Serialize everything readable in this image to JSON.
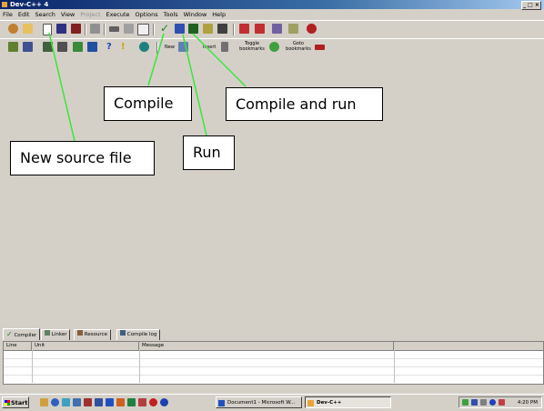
{
  "window": {
    "title": "Dev-C++ 4",
    "controls": "_ □ ×"
  },
  "menu": [
    {
      "label": "File",
      "dim": false
    },
    {
      "label": "Edit",
      "dim": false
    },
    {
      "label": "Search",
      "dim": false
    },
    {
      "label": "View",
      "dim": false
    },
    {
      "label": "Project",
      "dim": true
    },
    {
      "label": "Execute",
      "dim": false
    },
    {
      "label": "Options",
      "dim": false
    },
    {
      "label": "Tools",
      "dim": false
    },
    {
      "label": "Window",
      "dim": false
    },
    {
      "label": "Help",
      "dim": false
    }
  ],
  "toolbar2": {
    "new_label": "New",
    "insert_label": "Insert",
    "toggle_label": "Toggle bookmarks",
    "goto_label": "Goto bookmarks"
  },
  "callouts": {
    "compile": "Compile",
    "compile_and_run": "Compile and run",
    "run": "Run",
    "new_source_file": "New source file"
  },
  "bottom_tabs": [
    "Compiler",
    "Linker",
    "Resource",
    "Compile log"
  ],
  "grid_columns": [
    "Line",
    "Unit",
    "Message"
  ],
  "taskbar": {
    "start": "Start",
    "tasks": [
      "Document1 - Microsoft W...",
      "Dev-C++"
    ],
    "clock": "4:20 PM"
  },
  "colors": {
    "annotation_line": "#39e639",
    "title_start": "#0a246a",
    "title_end": "#a6caf0"
  }
}
